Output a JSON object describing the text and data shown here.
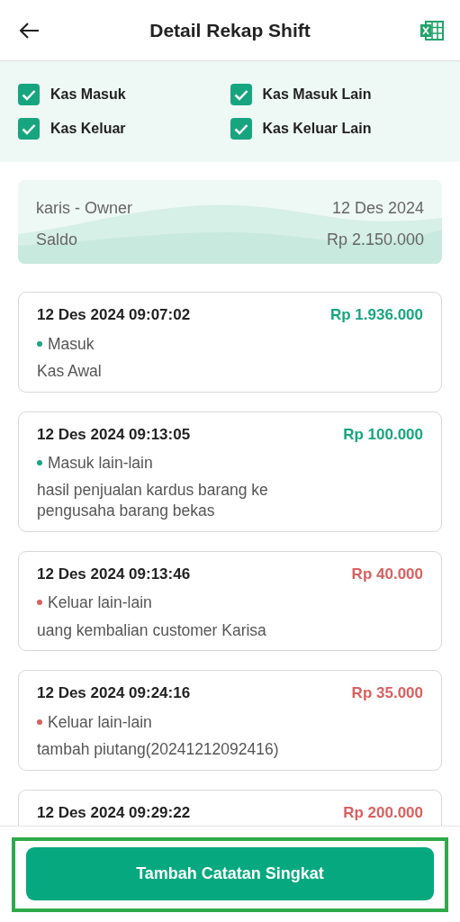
{
  "header": {
    "title": "Detail Rekap Shift"
  },
  "filters": [
    {
      "label": "Kas Masuk",
      "checked": true
    },
    {
      "label": "Kas Masuk Lain",
      "checked": true
    },
    {
      "label": "Kas Keluar",
      "checked": true
    },
    {
      "label": "Kas Keluar Lain",
      "checked": true
    }
  ],
  "summary": {
    "user": "karis - Owner",
    "date": "12 Des 2024",
    "balance_label": "Saldo",
    "balance": "Rp 2.150.000"
  },
  "entries": [
    {
      "kind": "in",
      "datetime": "12 Des 2024 09:07:02",
      "amount": "Rp 1.936.000",
      "category": "Masuk",
      "note": "Kas Awal"
    },
    {
      "kind": "in",
      "datetime": "12 Des 2024 09:13:05",
      "amount": "Rp 100.000",
      "category": "Masuk lain-lain",
      "note": "hasil penjualan kardus barang ke pengusaha barang bekas"
    },
    {
      "kind": "out",
      "datetime": "12 Des 2024 09:13:46",
      "amount": "Rp 40.000",
      "category": "Keluar lain-lain",
      "note": "uang kembalian customer Karisa"
    },
    {
      "kind": "out",
      "datetime": "12 Des 2024 09:24:16",
      "amount": "Rp 35.000",
      "category": "Keluar lain-lain",
      "note": "tambah piutang(20241212092416)"
    },
    {
      "kind": "out",
      "datetime": "12 Des 2024 09:29:22",
      "amount": "Rp 200.000"
    }
  ],
  "bottom_bar": {
    "button": "Tambah Catatan Singkat",
    "highlighted": true
  }
}
